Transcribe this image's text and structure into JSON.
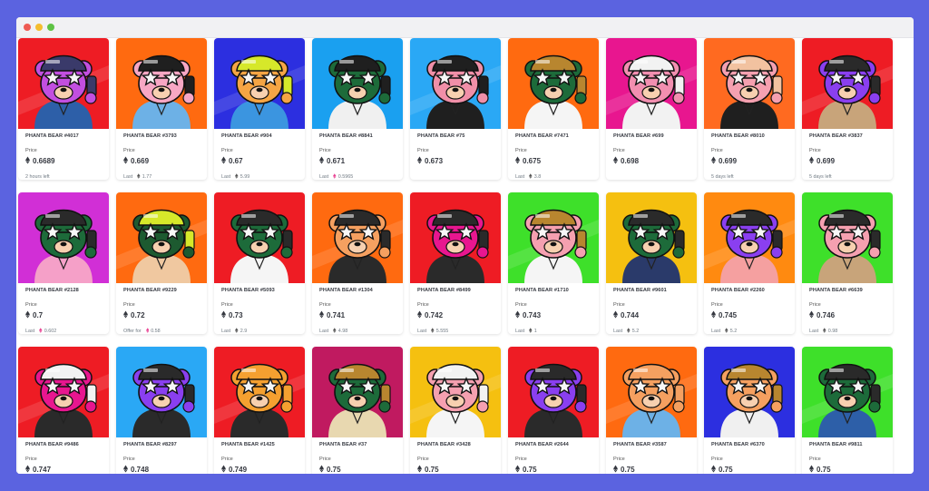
{
  "window": {
    "title": ""
  },
  "labels": {
    "price": "Price"
  },
  "rows": [
    [
      {
        "name": "PHANTA BEAR #4017",
        "price": "0.6689",
        "sub_prefix": "2 hours left",
        "sub_value": "",
        "sub_eth": "",
        "bg": "#ee1c24",
        "fur": "#c24fe0",
        "hat": "#3a3a6a",
        "shirt": "#2d5fa8"
      },
      {
        "name": "PHANTA BEAR #3793",
        "price": "0.669",
        "sub_prefix": "Last",
        "sub_value": "1.77",
        "sub_eth": "gray",
        "bg": "#ff6a10",
        "fur": "#f7a7c4",
        "hat": "#1f1f1f",
        "shirt": "#6db1e6"
      },
      {
        "name": "PHANTA BEAR #904",
        "price": "0.67",
        "sub_prefix": "Last",
        "sub_value": "5.99",
        "sub_eth": "gray",
        "bg": "#2c2fe0",
        "fur": "#f5a544",
        "hat": "#d6e82a",
        "shirt": "#3b95e0"
      },
      {
        "name": "PHANTA BEAR #8841",
        "price": "0.671",
        "sub_prefix": "Last",
        "sub_value": "0.5965",
        "sub_eth": "pink",
        "bg": "#1aa0f0",
        "fur": "#1d6b3a",
        "hat": "#1f1f1f",
        "shirt": "#f0f0f0"
      },
      {
        "name": "PHANTA BEAR #75",
        "price": "0.673",
        "sub_prefix": "",
        "sub_value": "",
        "sub_eth": "",
        "bg": "#2aa8f5",
        "fur": "#f08fa8",
        "hat": "#1f1f1f",
        "shirt": "#1f1f1f"
      },
      {
        "name": "PHANTA BEAR #7471",
        "price": "0.675",
        "sub_prefix": "Last",
        "sub_value": "3.8",
        "sub_eth": "gray",
        "bg": "#ff6a10",
        "fur": "#1d6b3a",
        "hat": "#b8862f",
        "shirt": "#f5f5f5"
      },
      {
        "name": "PHANTA BEAR #699",
        "price": "0.698",
        "sub_prefix": "",
        "sub_value": "",
        "sub_eth": "",
        "bg": "#e8168f",
        "fur": "#f28fb0",
        "hat": "#f2f2f2",
        "shirt": "#f2f2f2"
      },
      {
        "name": "PHANTA BEAR #8010",
        "price": "0.699",
        "sub_prefix": "5 days left",
        "sub_value": "",
        "sub_eth": "",
        "bg": "#ff6a20",
        "fur": "#f5a0b0",
        "hat": "#f2c2a0",
        "shirt": "#1f1f1f"
      },
      {
        "name": "PHANTA BEAR #3837",
        "price": "0.699",
        "sub_prefix": "5 days left",
        "sub_value": "",
        "sub_eth": "",
        "bg": "#ee1c24",
        "fur": "#8a3ff0",
        "hat": "#2a2a2a",
        "shirt": "#c8a47a"
      }
    ],
    [
      {
        "name": "PHANTA BEAR #2128",
        "price": "0.7",
        "sub_prefix": "Last",
        "sub_value": "0.602",
        "sub_eth": "pink",
        "bg": "#d12fd6",
        "fur": "#1d6b3a",
        "hat": "#2a2a2a",
        "shirt": "#f5a0c8"
      },
      {
        "name": "PHANTA BEAR #9229",
        "price": "0.72",
        "sub_prefix": "Offer for",
        "sub_value": "0.58",
        "sub_eth": "pink",
        "bg": "#ff6a10",
        "fur": "#1d5a30",
        "hat": "#d6e82a",
        "shirt": "#f0c8a0"
      },
      {
        "name": "PHANTA BEAR #5093",
        "price": "0.73",
        "sub_prefix": "Last",
        "sub_value": "2.9",
        "sub_eth": "gray",
        "bg": "#ee1c24",
        "fur": "#1d6b3a",
        "hat": "#2a2a2a",
        "shirt": "#f5f5f5"
      },
      {
        "name": "PHANTA BEAR #1304",
        "price": "0.741",
        "sub_prefix": "Last",
        "sub_value": "4.98",
        "sub_eth": "gray",
        "bg": "#ff6a10",
        "fur": "#f5a060",
        "hat": "#2a2a2a",
        "shirt": "#2a2a2a"
      },
      {
        "name": "PHANTA BEAR #8499",
        "price": "0.742",
        "sub_prefix": "Last",
        "sub_value": "5.555",
        "sub_eth": "gray",
        "bg": "#ee1c24",
        "fur": "#e8168f",
        "hat": "#2a2a2a",
        "shirt": "#2a2a2a"
      },
      {
        "name": "PHANTA BEAR #1710",
        "price": "0.743",
        "sub_prefix": "Last",
        "sub_value": "1",
        "sub_eth": "gray",
        "bg": "#3ee02a",
        "fur": "#f5a0b0",
        "hat": "#b8862f",
        "shirt": "#f5f5f5"
      },
      {
        "name": "PHANTA BEAR #9601",
        "price": "0.744",
        "sub_prefix": "Last",
        "sub_value": "5.2",
        "sub_eth": "gray",
        "bg": "#f5c010",
        "fur": "#1d6b3a",
        "hat": "#2a2a2a",
        "shirt": "#2a3a6a"
      },
      {
        "name": "PHANTA BEAR #2260",
        "price": "0.745",
        "sub_prefix": "Last",
        "sub_value": "5.2",
        "sub_eth": "gray",
        "bg": "#ff8a10",
        "fur": "#8a3ff0",
        "hat": "#2a2a2a",
        "shirt": "#f5a0a0"
      },
      {
        "name": "PHANTA BEAR #6639",
        "price": "0.746",
        "sub_prefix": "Last",
        "sub_value": "0.98",
        "sub_eth": "gray",
        "bg": "#3ee02a",
        "fur": "#f5a0b0",
        "hat": "#2a2a2a",
        "shirt": "#c8a47a"
      }
    ],
    [
      {
        "name": "PHANTA BEAR #9486",
        "price": "0.747",
        "sub_prefix": "",
        "sub_value": "",
        "sub_eth": "",
        "bg": "#ee1c24",
        "fur": "#e8168f",
        "hat": "#f2f2f2",
        "shirt": "#2a2a2a"
      },
      {
        "name": "PHANTA BEAR #8297",
        "price": "0.748",
        "sub_prefix": "",
        "sub_value": "",
        "sub_eth": "",
        "bg": "#2aa8f5",
        "fur": "#8a3ff0",
        "hat": "#2a2a2a",
        "shirt": "#2a2a2a"
      },
      {
        "name": "PHANTA BEAR #1425",
        "price": "0.749",
        "sub_prefix": "",
        "sub_value": "",
        "sub_eth": "",
        "bg": "#ee1c24",
        "fur": "#f5a030",
        "hat": "#f5a030",
        "shirt": "#2a2a2a"
      },
      {
        "name": "PHANTA BEAR #37",
        "price": "0.75",
        "sub_prefix": "",
        "sub_value": "",
        "sub_eth": "",
        "bg": "#c01a60",
        "fur": "#1d6b3a",
        "hat": "#b8862f",
        "shirt": "#e8d8b0"
      },
      {
        "name": "PHANTA BEAR #3428",
        "price": "0.75",
        "sub_prefix": "",
        "sub_value": "",
        "sub_eth": "",
        "bg": "#f5c010",
        "fur": "#f5a0b0",
        "hat": "#f2f2f2",
        "shirt": "#f5f5f5"
      },
      {
        "name": "PHANTA BEAR #2644",
        "price": "0.75",
        "sub_prefix": "",
        "sub_value": "",
        "sub_eth": "",
        "bg": "#ee1c24",
        "fur": "#8a3ff0",
        "hat": "#2a2a2a",
        "shirt": "#2a2a2a"
      },
      {
        "name": "PHANTA BEAR #3587",
        "price": "0.75",
        "sub_prefix": "",
        "sub_value": "",
        "sub_eth": "",
        "bg": "#ff6a10",
        "fur": "#f5a060",
        "hat": "#f5a060",
        "shirt": "#6db1e6"
      },
      {
        "name": "PHANTA BEAR #6370",
        "price": "0.75",
        "sub_prefix": "",
        "sub_value": "",
        "sub_eth": "",
        "bg": "#2c2fe0",
        "fur": "#f5a060",
        "hat": "#b8862f",
        "shirt": "#f0f0f0"
      },
      {
        "name": "PHANTA BEAR #9811",
        "price": "0.75",
        "sub_prefix": "",
        "sub_value": "",
        "sub_eth": "",
        "bg": "#3ee02a",
        "fur": "#1d6b3a",
        "hat": "#2a2a2a",
        "shirt": "#2d5fa8"
      }
    ]
  ],
  "colors": {
    "page_bg": "#5b63e0",
    "text_dark": "#353840",
    "text_muted": "#707a83",
    "eth_pink": "#e84393"
  }
}
